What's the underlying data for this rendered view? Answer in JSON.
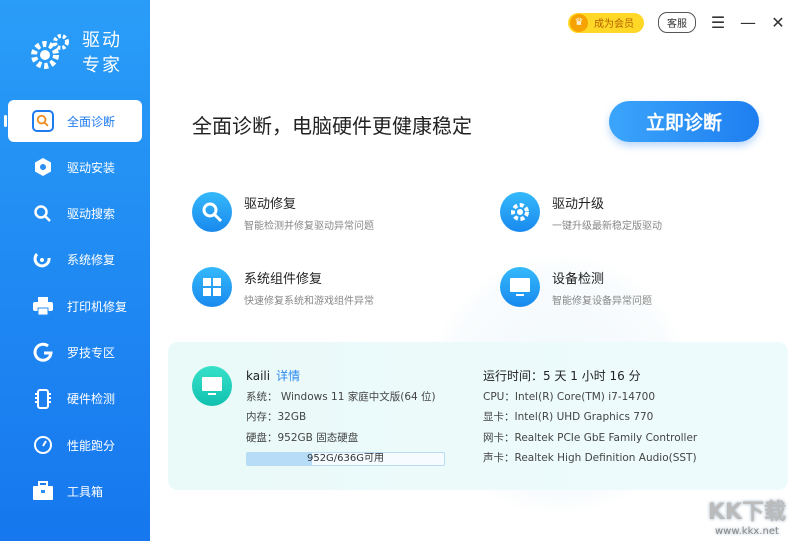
{
  "sidebar": {
    "logo": "驱动专家",
    "logo_line1": "驱动",
    "logo_line2": "专家",
    "items": [
      {
        "label": "全面诊断",
        "icon": "search-icon"
      },
      {
        "label": "驱动安装",
        "icon": "hexagon-gear-icon"
      },
      {
        "label": "驱动搜索",
        "icon": "search-icon"
      },
      {
        "label": "系统修复",
        "icon": "wrench-icon"
      },
      {
        "label": "打印机修复",
        "icon": "printer-icon"
      },
      {
        "label": "罗技专区",
        "icon": "logitech-icon"
      },
      {
        "label": "硬件检测",
        "icon": "chip-icon"
      },
      {
        "label": "性能跑分",
        "icon": "gauge-icon"
      },
      {
        "label": "工具箱",
        "icon": "toolbox-icon"
      }
    ]
  },
  "topbar": {
    "vip": "成为会员",
    "service": "客服"
  },
  "main": {
    "headline": "全面诊断，电脑硬件更健康稳定",
    "diagnose_button": "立即诊断",
    "features": [
      {
        "title": "驱动修复",
        "subtitle": "智能检测并修复驱动异常问题"
      },
      {
        "title": "驱动升级",
        "subtitle": "一键升级最新稳定版驱动"
      },
      {
        "title": "系统组件修复",
        "subtitle": "快速修复系统和游戏组件异常"
      },
      {
        "title": "设备检测",
        "subtitle": "智能修复设备异常问题"
      }
    ]
  },
  "info": {
    "user": "kaili",
    "details_link": "详情",
    "os": "系统： Windows 11 家庭中文版(64 位)",
    "memory": "内存：32GB",
    "disk": "硬盘：952GB 固态硬盘",
    "disk_usage_text": "952G/636G可用",
    "disk_used_percent": 33,
    "uptime": "运行时间：5 天 1 小时 16 分",
    "cpu": "CPU：Intel(R) Core(TM) i7-14700",
    "gpu": "显卡：Intel(R) UHD Graphics 770",
    "nic": "网卡：Realtek PCIe GbE Family Controller",
    "audio": "声卡：Realtek High Definition Audio(SST)"
  },
  "watermark": {
    "big": "KK下载",
    "small": "www.kkx.net"
  }
}
